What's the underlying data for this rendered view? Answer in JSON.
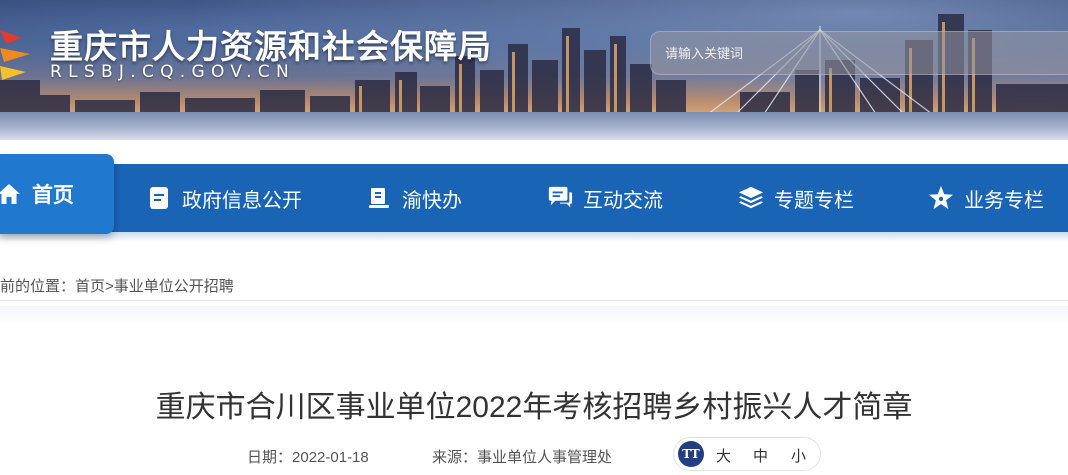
{
  "header": {
    "site_title": "重庆市人力资源和社会保障局",
    "site_domain": "RLSBJ.CQ.GOV.CN",
    "search_placeholder": "请输入关键词"
  },
  "nav": {
    "items": [
      {
        "label": "首页",
        "icon": "home-icon",
        "active": true
      },
      {
        "label": "政府信息公开",
        "icon": "document-icon"
      },
      {
        "label": "渝快办",
        "icon": "book-icon"
      },
      {
        "label": "互动交流",
        "icon": "chat-icon"
      },
      {
        "label": "专题专栏",
        "icon": "layers-icon"
      },
      {
        "label": "业务专栏",
        "icon": "star-icon"
      }
    ]
  },
  "breadcrumb": {
    "prefix": "前的位置：",
    "home": "首页",
    "separator": ">",
    "current": "事业单位公开招聘"
  },
  "article": {
    "title": "重庆市合川区事业单位2022年考核招聘乡村振兴人才简章",
    "date_label": "日期：",
    "date": "2022-01-18",
    "source_label": "来源：",
    "source": "事业单位人事管理处"
  },
  "font_size": {
    "icon_text": "TT",
    "large": "大",
    "medium": "中",
    "small": "小"
  },
  "colors": {
    "nav_bar": "#1a64b5",
    "nav_active": "#2179cf",
    "font_icon": "#233f82"
  }
}
